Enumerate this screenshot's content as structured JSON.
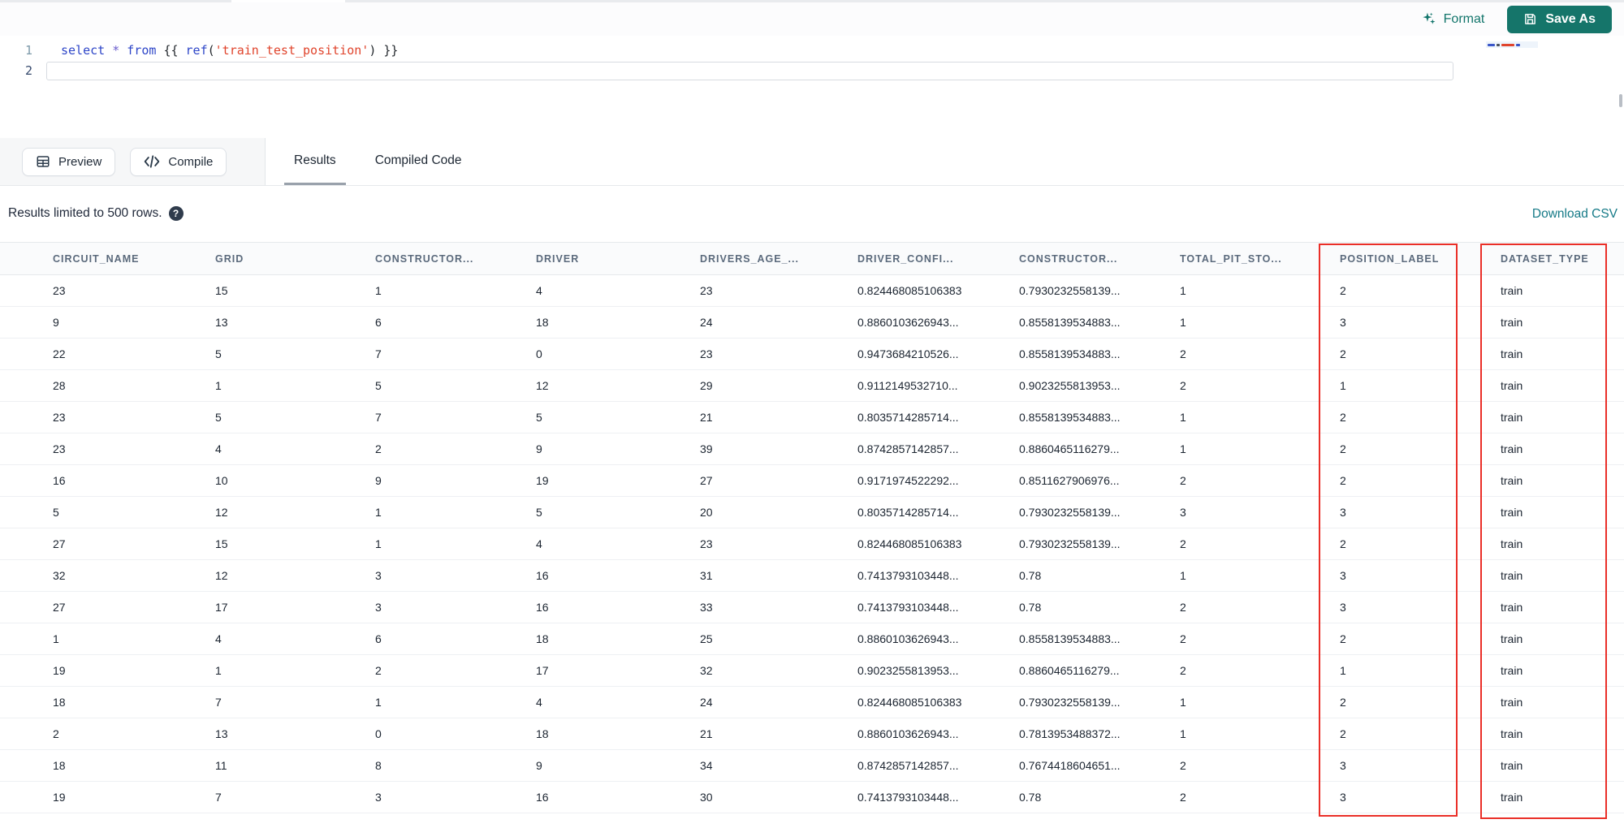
{
  "colors": {
    "accent_teal": "#15756a",
    "format_teal": "#12756b",
    "link_teal": "#157a87",
    "highlight_red": "#ea2f28"
  },
  "editor": {
    "format_label": "Format",
    "save_as_label": "Save As",
    "lines": [
      {
        "number": "1"
      },
      {
        "number": "2"
      }
    ],
    "code_tokens": [
      {
        "type": "kw",
        "text": "select"
      },
      {
        "type": "plain",
        "text": " "
      },
      {
        "type": "op",
        "text": "*"
      },
      {
        "type": "plain",
        "text": " "
      },
      {
        "type": "kw",
        "text": "from"
      },
      {
        "type": "plain",
        "text": " "
      },
      {
        "type": "punc",
        "text": "{{"
      },
      {
        "type": "plain",
        "text": " "
      },
      {
        "type": "fn",
        "text": "ref"
      },
      {
        "type": "punc",
        "text": "("
      },
      {
        "type": "str",
        "text": "'train_test_position'"
      },
      {
        "type": "punc",
        "text": ")"
      },
      {
        "type": "plain",
        "text": " "
      },
      {
        "type": "punc",
        "text": "}}"
      }
    ]
  },
  "action_bar": {
    "preview_label": "Preview",
    "compile_label": "Compile",
    "tabs": [
      {
        "label": "Results",
        "active": true
      },
      {
        "label": "Compiled Code",
        "active": false
      }
    ]
  },
  "results": {
    "limit_note": "Results limited to 500 rows.",
    "help_glyph": "?",
    "download_csv_label": "Download CSV"
  },
  "table": {
    "columns": [
      "CIRCUIT_NAME",
      "GRID",
      "CONSTRUCTOR...",
      "DRIVER",
      "DRIVERS_AGE_...",
      "DRIVER_CONFI...",
      "CONSTRUCTOR...",
      "TOTAL_PIT_STO...",
      "POSITION_LABEL",
      "DATASET_TYPE"
    ],
    "highlighted_columns": [
      "POSITION_LABEL",
      "DATASET_TYPE"
    ],
    "rows": [
      [
        "23",
        "15",
        "1",
        "4",
        "23",
        "0.824468085106383",
        "0.7930232558139...",
        "1",
        "2",
        "train"
      ],
      [
        "9",
        "13",
        "6",
        "18",
        "24",
        "0.8860103626943...",
        "0.8558139534883...",
        "1",
        "3",
        "train"
      ],
      [
        "22",
        "5",
        "7",
        "0",
        "23",
        "0.9473684210526...",
        "0.8558139534883...",
        "2",
        "2",
        "train"
      ],
      [
        "28",
        "1",
        "5",
        "12",
        "29",
        "0.9112149532710...",
        "0.9023255813953...",
        "2",
        "1",
        "train"
      ],
      [
        "23",
        "5",
        "7",
        "5",
        "21",
        "0.8035714285714...",
        "0.8558139534883...",
        "1",
        "2",
        "train"
      ],
      [
        "23",
        "4",
        "2",
        "9",
        "39",
        "0.8742857142857...",
        "0.8860465116279...",
        "1",
        "2",
        "train"
      ],
      [
        "16",
        "10",
        "9",
        "19",
        "27",
        "0.9171974522292...",
        "0.8511627906976...",
        "2",
        "2",
        "train"
      ],
      [
        "5",
        "12",
        "1",
        "5",
        "20",
        "0.8035714285714...",
        "0.7930232558139...",
        "3",
        "3",
        "train"
      ],
      [
        "27",
        "15",
        "1",
        "4",
        "23",
        "0.824468085106383",
        "0.7930232558139...",
        "2",
        "2",
        "train"
      ],
      [
        "32",
        "12",
        "3",
        "16",
        "31",
        "0.7413793103448...",
        "0.78",
        "1",
        "3",
        "train"
      ],
      [
        "27",
        "17",
        "3",
        "16",
        "33",
        "0.7413793103448...",
        "0.78",
        "2",
        "3",
        "train"
      ],
      [
        "1",
        "4",
        "6",
        "18",
        "25",
        "0.8860103626943...",
        "0.8558139534883...",
        "2",
        "2",
        "train"
      ],
      [
        "19",
        "1",
        "2",
        "17",
        "32",
        "0.9023255813953...",
        "0.8860465116279...",
        "2",
        "1",
        "train"
      ],
      [
        "18",
        "7",
        "1",
        "4",
        "24",
        "0.824468085106383",
        "0.7930232558139...",
        "1",
        "2",
        "train"
      ],
      [
        "2",
        "13",
        "0",
        "18",
        "21",
        "0.8860103626943...",
        "0.7813953488372...",
        "1",
        "2",
        "train"
      ],
      [
        "18",
        "11",
        "8",
        "9",
        "34",
        "0.8742857142857...",
        "0.7674418604651...",
        "2",
        "3",
        "train"
      ],
      [
        "19",
        "7",
        "3",
        "16",
        "30",
        "0.7413793103448...",
        "0.78",
        "2",
        "3",
        "train"
      ]
    ]
  }
}
